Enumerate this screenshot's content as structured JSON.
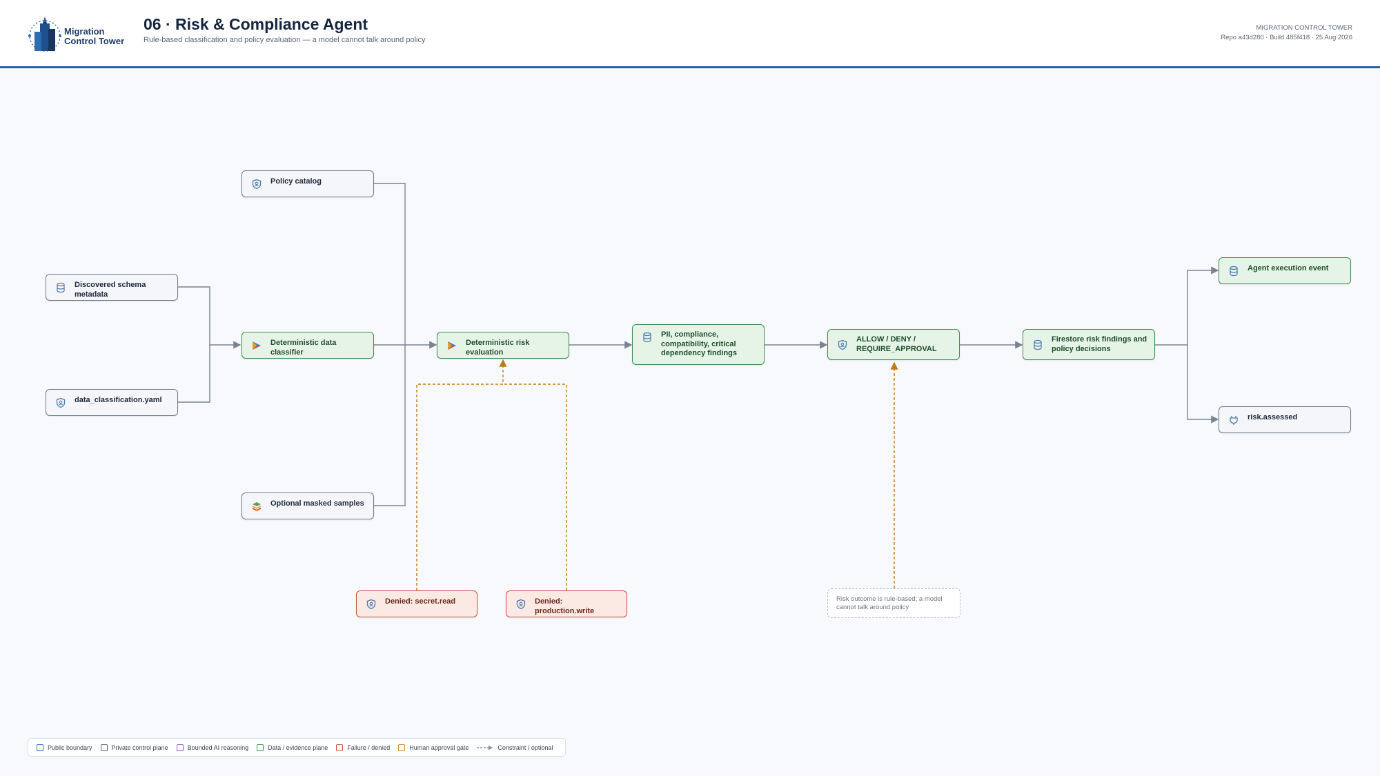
{
  "header": {
    "logo_line1": "Migration",
    "logo_line2": "Control Tower",
    "title": "06 · Risk & Compliance Agent",
    "subtitle": "Rule-based classification and policy evaluation — a model cannot talk around policy",
    "meta_title": "MIGRATION CONTROL TOWER",
    "meta_build": "Repo a43d280 · Build 485f418 · 25 Aug 2026"
  },
  "nodes": {
    "policy_catalog": {
      "label": "Policy catalog",
      "icon": "shield-icon"
    },
    "schema_metadata": {
      "label": "Discovered schema metadata",
      "icon": "database-icon"
    },
    "data_classification": {
      "label": "data_classification.yaml",
      "icon": "shield-icon"
    },
    "data_classifier": {
      "label": "Deterministic data classifier",
      "icon": "play-icon"
    },
    "risk_evaluation": {
      "label": "Deterministic risk evaluation",
      "icon": "play-icon"
    },
    "masked_samples": {
      "label": "Optional masked samples",
      "icon": "layers-icon"
    },
    "findings": {
      "label": "PII, compliance, compatibility, critical dependency findings",
      "icon": "database-icon"
    },
    "decision": {
      "label": "ALLOW / DENY / REQUIRE_APPROVAL",
      "icon": "shield-icon"
    },
    "firestore": {
      "label": "Firestore risk findings and policy decisions",
      "icon": "database-icon"
    },
    "execution_event": {
      "label": "Agent execution event",
      "icon": "database-icon"
    },
    "risk_assessed": {
      "label": "risk.assessed",
      "icon": "plug-icon"
    },
    "denied_secret": {
      "label": "Denied: secret.read",
      "icon": "shield-icon"
    },
    "denied_production": {
      "label": "Denied: production.write",
      "icon": "shield-icon"
    },
    "note": {
      "label": "Risk outcome is rule-based; a model cannot talk around policy"
    }
  },
  "legend": [
    {
      "label": "Public boundary",
      "color": "#2f6db3"
    },
    {
      "label": "Private control plane",
      "color": "#5a6675"
    },
    {
      "label": "Bounded AI reasoning",
      "color": "#8a5cc2"
    },
    {
      "label": "Data / evidence plane",
      "color": "#3f8a52"
    },
    {
      "label": "Failure / denied",
      "color": "#c0563f"
    },
    {
      "label": "Human approval gate",
      "color": "#c78a1f"
    },
    {
      "label": "Constraint / optional",
      "color": "#8a929c"
    }
  ]
}
